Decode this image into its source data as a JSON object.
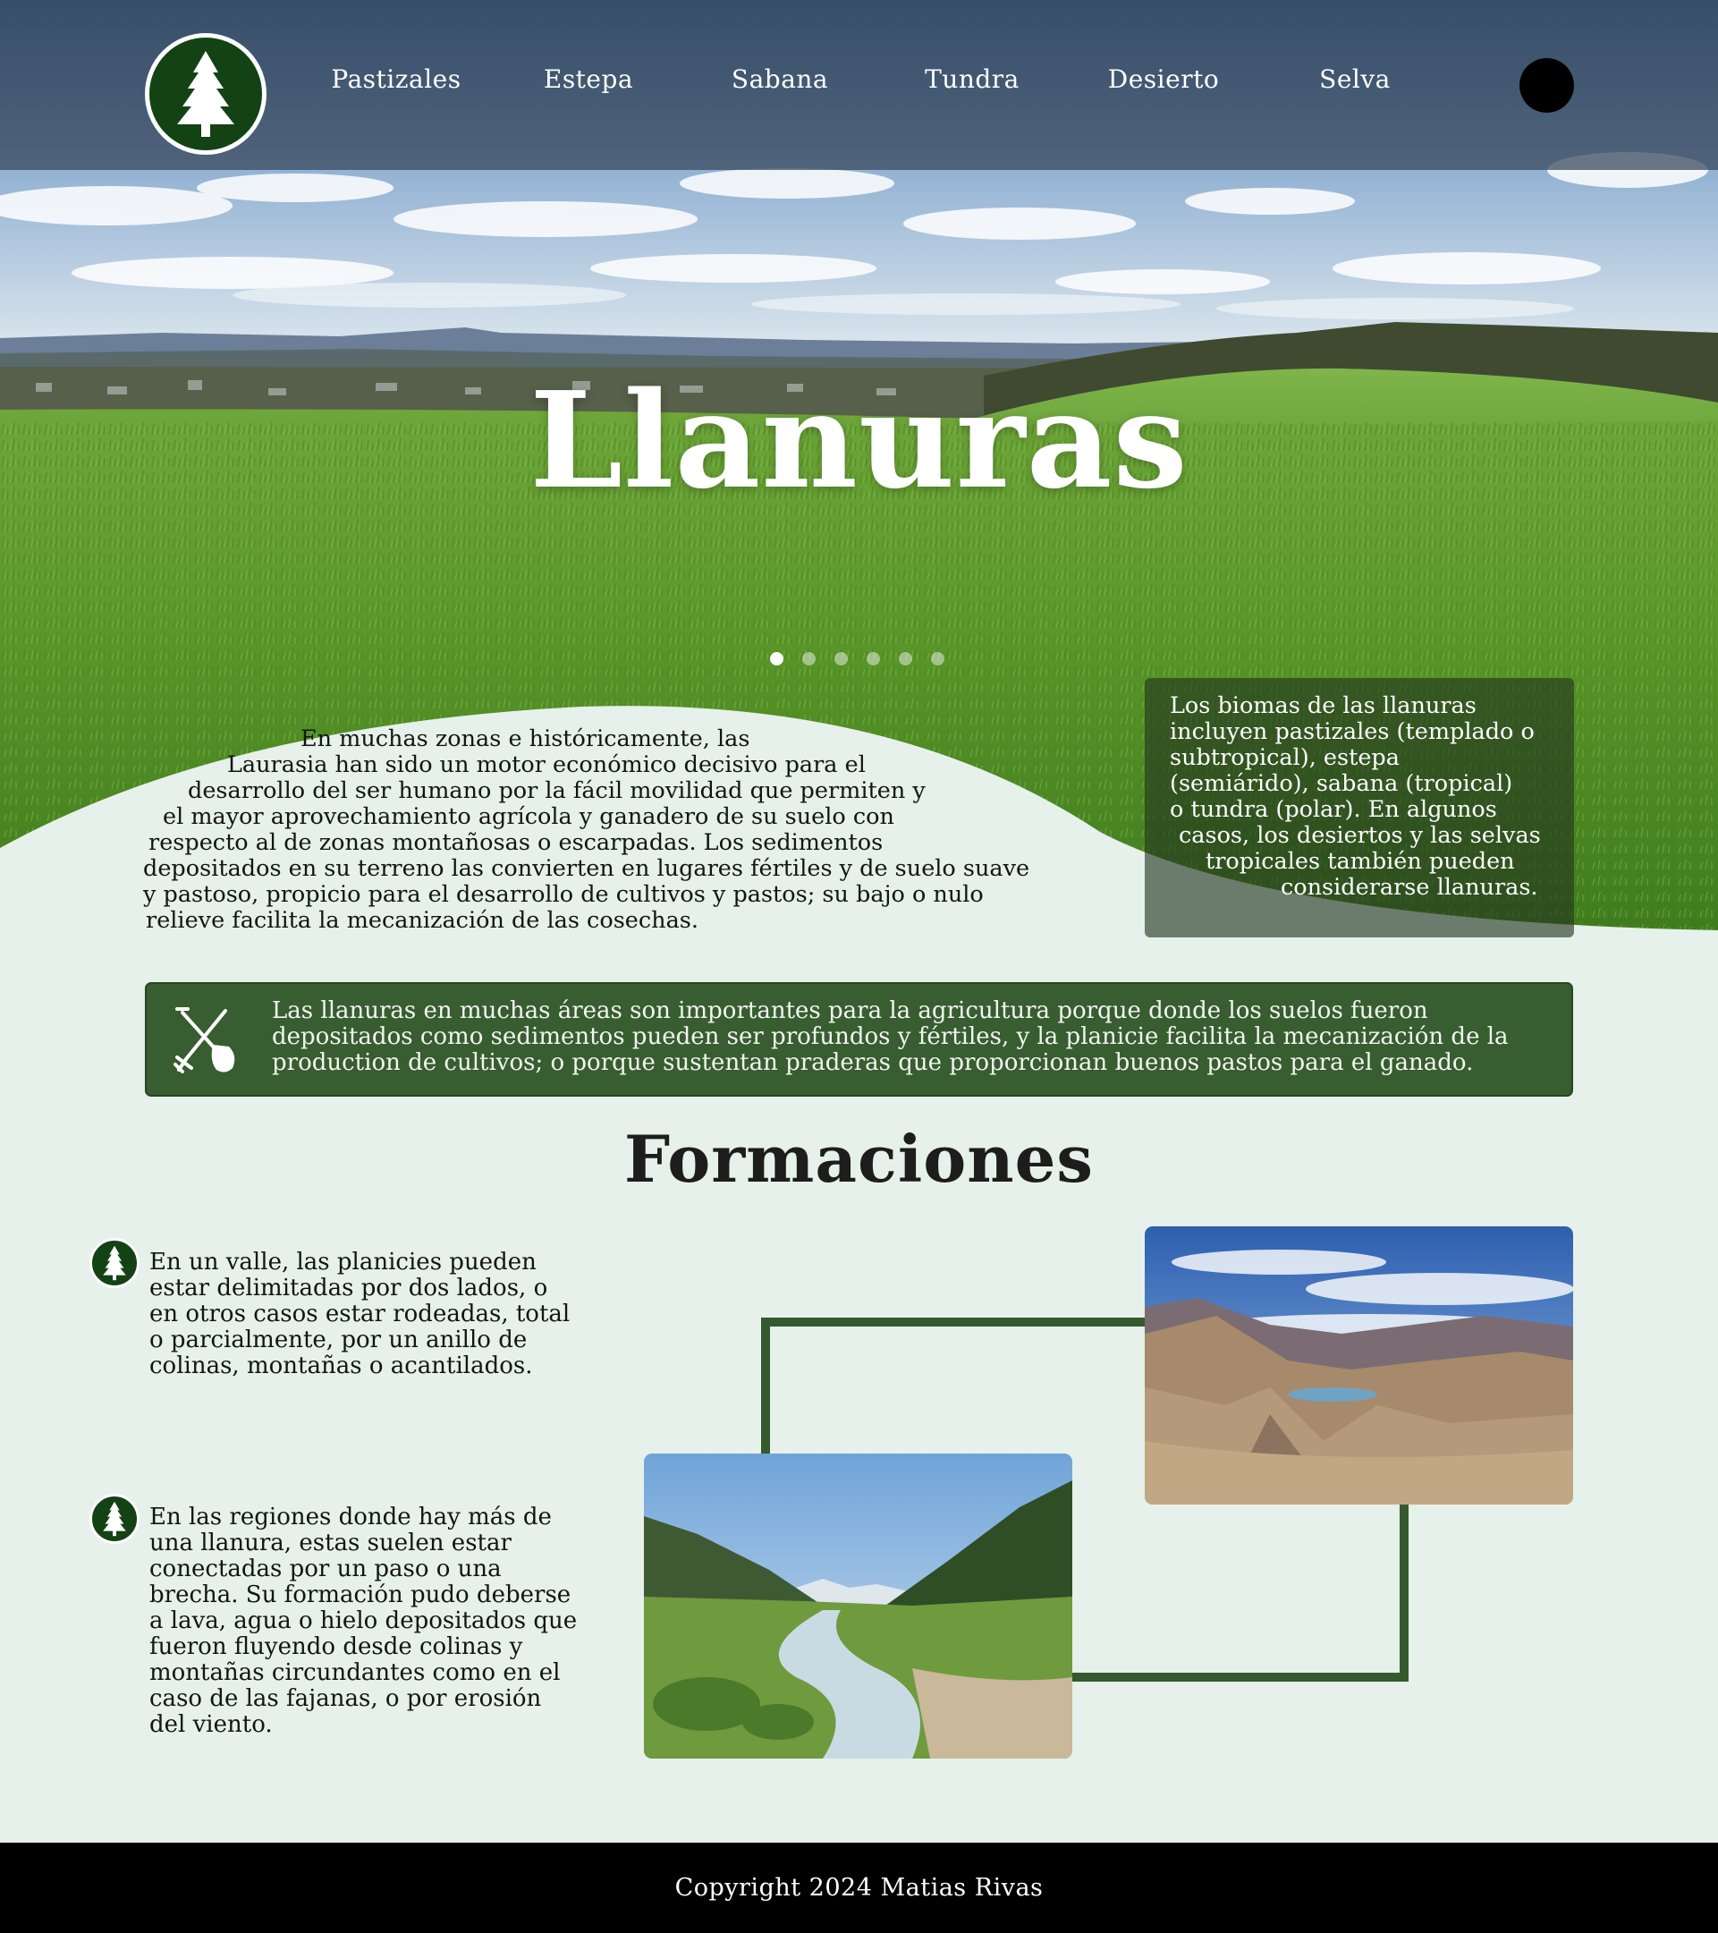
{
  "nav": {
    "items": [
      {
        "label": "Pastizales"
      },
      {
        "label": "Estepa"
      },
      {
        "label": "Sabana"
      },
      {
        "label": "Tundra"
      },
      {
        "label": "Desierto"
      },
      {
        "label": "Selva"
      }
    ],
    "logo_icon": "pine-tree-icon",
    "menu_icon": "circle-menu-icon"
  },
  "hero": {
    "title": "Llanuras",
    "carousel": {
      "total": 6,
      "active": 1
    },
    "side_note_lines": [
      "Los biomas de las llanuras",
      "incluyen pastizales (templado o",
      "subtropical), estepa",
      "(semiárido), sabana (tropical)",
      "o tundra (polar). En algunos",
      "casos, los desiertos y las selvas",
      "tropicales también pueden",
      "considerarse llanuras."
    ],
    "intro_lines": [
      "En muchas zonas e históricamente, las",
      "Laurasia han sido un motor económico decisivo para el",
      "desarrollo del ser humano por la fácil movilidad que permiten y",
      "el mayor aprovechamiento agrícola y ganadero de su suelo con",
      "respecto al de zonas montañosas o escarpadas. Los sedimentos",
      "depositados en su terreno las convierten en lugares fértiles y de suelo suave",
      "y pastoso, propicio para el desarrollo de cultivos y pastos; su bajo o nulo",
      "relieve facilita la mecanización de las cosechas."
    ]
  },
  "feature": {
    "icon": "farm-tools-icon",
    "lines": [
      "Las llanuras en muchas áreas son importantes para la agricultura porque donde los suelos fueron",
      "depositados como sedimentos pueden ser profundos y fértiles, y la planicie facilita la mecanización de la",
      "production de cultivos; o porque sustentan praderas que proporcionan buenos pastos para el ganado."
    ]
  },
  "formaciones": {
    "title": "Formaciones",
    "items": [
      {
        "icon": "pine-tree-icon",
        "lines": [
          "En un valle, las planicies pueden",
          "estar delimitadas por dos lados, o",
          "en otros casos estar rodeadas, total",
          "o parcialmente, por un anillo de",
          "colinas, montañas o acantilados."
        ],
        "image": "mountain-valley-with-lake-photo"
      },
      {
        "icon": "pine-tree-icon",
        "lines": [
          "En las regiones donde hay más de",
          "una llanura, estas suelen estar",
          "conectadas por un paso o una",
          "brecha. Su formación pudo deberse",
          "a lava, agua o hielo depositados que",
          "fueron fluyendo desde colinas y",
          "montañas circundantes como en el",
          "caso de las fajanas, o por erosión",
          "del viento."
        ],
        "image": "river-valley-photo"
      }
    ]
  },
  "footer": {
    "text": "Copyright 2024 Matias Rivas"
  },
  "colors": {
    "page_bg": "#e5f1ea",
    "brand_green": "#134314",
    "feature_green": "#385d30",
    "connector_green": "#345a2d",
    "footer_bg": "#000000"
  }
}
